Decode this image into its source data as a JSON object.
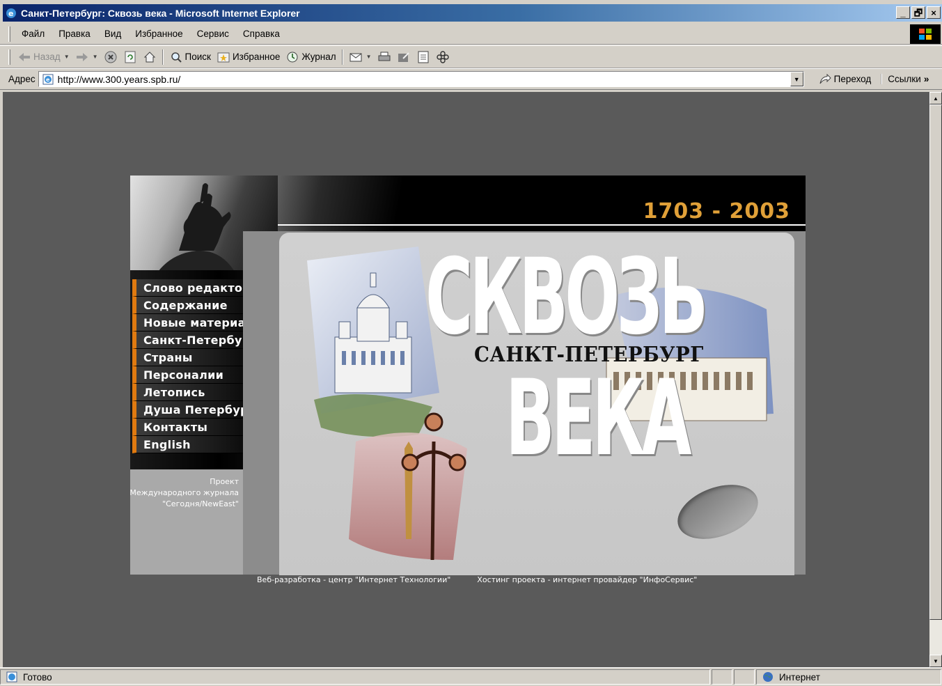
{
  "window": {
    "title": "Санкт-Петербург: Сквозь века - Microsoft Internet Explorer",
    "buttons": [
      "_",
      "🗗",
      "×"
    ]
  },
  "menu": [
    "Файл",
    "Правка",
    "Вид",
    "Избранное",
    "Сервис",
    "Справка"
  ],
  "toolbar": {
    "back": "Назад",
    "search": "Поиск",
    "favorites": "Избранное",
    "history": "Журнал"
  },
  "address": {
    "label": "Адрес",
    "url": "http://www.300.years.spb.ru/",
    "go": "Переход",
    "links": "Ссылки",
    "links_chevron": "»"
  },
  "site": {
    "dates": "1703 - 2003",
    "nav": [
      {
        "label": "Слово редактора"
      },
      {
        "label": "Содержание"
      },
      {
        "label": "Новые материалы"
      },
      {
        "label": "Санкт-Петербург"
      },
      {
        "label": "Страны"
      },
      {
        "label": "Персоналии"
      },
      {
        "label": "Летопись"
      },
      {
        "label": "Душа Петербурга"
      },
      {
        "label": "Контакты"
      },
      {
        "label": "English"
      }
    ],
    "project_lines": [
      "Проект",
      "Международного журнала",
      "\"Сегодня/NewEast\""
    ],
    "brand_line1": "СКВОЗЬ",
    "brand_line2": "ВЕКА",
    "brand_city": "САНКТ-ПЕТЕРБУРГ",
    "credit_dev": "Веб-разработка - центр \"Интернет Технологии\"",
    "credit_hosting": "Хостинг проекта - интернет провайдер \"ИнфоСервис\""
  },
  "status": {
    "text": "Готово",
    "zone": "Интернет"
  },
  "colors": {
    "accent_orange": "#e07a10",
    "dates_gold": "#e0a038",
    "page_bg": "#5a5a5a",
    "title_bar": "#0a246a"
  }
}
